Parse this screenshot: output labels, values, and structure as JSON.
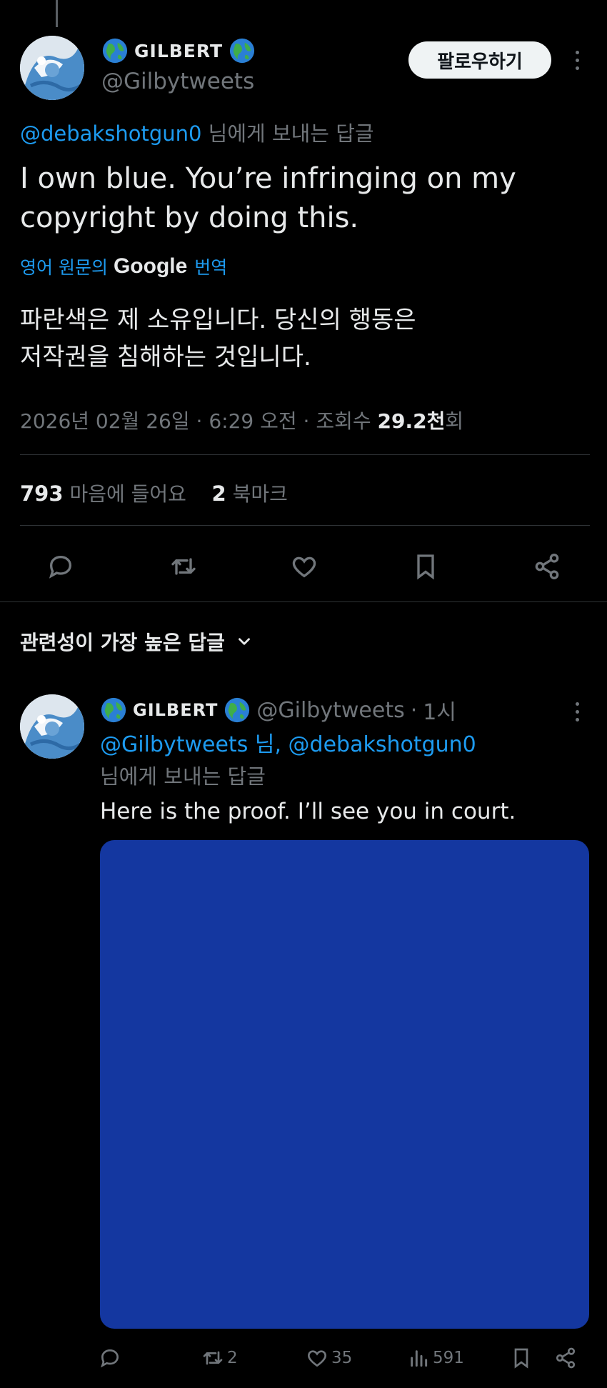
{
  "tweet": {
    "author_name": "GILBERT",
    "author_handle": "@Gilbytweets",
    "follow_label": "팔로우하기",
    "reply_to_user": "@debakshotgun0",
    "reply_to_suffix": "님에게 보내는 답글",
    "text_line1": "I own blue. You’re infringing on my",
    "text_line2": "copyright by doing this.",
    "translate_prefix": "영어 원문의",
    "translate_google": "Google",
    "translate_suffix": "번역",
    "translated_line1": "파란색은 제 소유입니다. 당신의 행동은",
    "translated_line2": "저작권을 침해하는 것입니다.",
    "date": "2026년 02월 26일",
    "time": "6:29 오전",
    "views_label": "조회수",
    "views_value": "29.2천",
    "views_unit": "회",
    "likes_count": "793",
    "likes_label": "마음에 들어요",
    "bookmarks_count": "2",
    "bookmarks_label": "북마크"
  },
  "sort": {
    "label": "관련성이 가장 높은 답글"
  },
  "reply": {
    "author_name": "GILBERT",
    "author_handle": "@Gilbytweets",
    "time": "1시",
    "mention_line": "@Gilbytweets 님, @debakshotgun0",
    "mention_suffix": "님에게 보내는 답글",
    "text": "Here is the proof. I’ll see you in court.",
    "image_color": "#1437a0",
    "retweets": "2",
    "likes": "35",
    "views": "591"
  },
  "colors": {
    "accent": "#1d9bf0",
    "muted": "#71767b",
    "background": "#000000",
    "divider": "#2f3336"
  },
  "icons": [
    "globe-icon",
    "more-icon",
    "reply-icon",
    "retweet-icon",
    "like-icon",
    "bookmark-icon",
    "share-icon",
    "views-icon",
    "chevron-down-icon"
  ]
}
